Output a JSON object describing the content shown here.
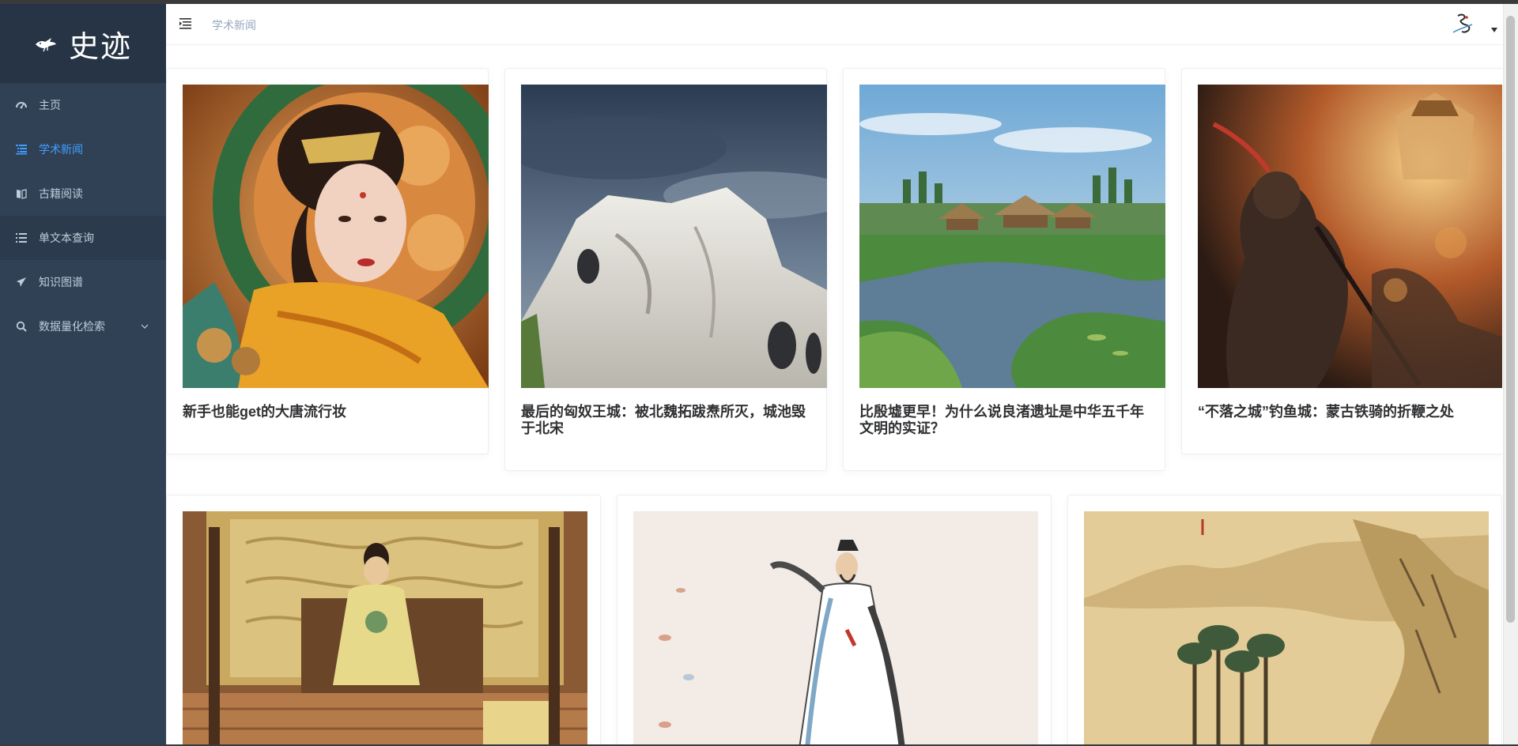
{
  "app": {
    "logo_text": "史迹",
    "logo_icon": "bird-logo-icon"
  },
  "sidebar": {
    "items": [
      {
        "label": "主页",
        "icon": "dashboard-icon"
      },
      {
        "label": "学术新闻",
        "icon": "list-indent-icon",
        "active": true
      },
      {
        "label": "古籍阅读",
        "icon": "book-icon"
      },
      {
        "label": "单文本查询",
        "icon": "list-icon"
      },
      {
        "label": "知识图谱",
        "icon": "send-icon"
      },
      {
        "label": "数据量化检索",
        "icon": "search-icon",
        "has_submenu": true
      }
    ]
  },
  "header": {
    "breadcrumb": "学术新闻",
    "menu_icon": "hamburger-icon",
    "avatar_icon": "avatar-icon"
  },
  "colors": {
    "sidebar_bg": "#304156",
    "logo_bg": "#263445",
    "active": "#409eff",
    "menu_text": "#bfcbd9"
  },
  "news": [
    {
      "title": "新手也能get的大唐流行妆",
      "image": "tang-lady-painting"
    },
    {
      "title": "最后的匈奴王城：被北魏拓跋焘所灭，城池毁于北宋",
      "image": "ruined-city-wall"
    },
    {
      "title": "比殷墟更早！为什么说良渚遗址是中华五千年文明的实证？",
      "image": "liangzhu-village-river"
    },
    {
      "title": "“不落之城”钓鱼城：蒙古铁骑的折鞭之处",
      "image": "battle-warrior-painting"
    },
    {
      "title": "",
      "image": "emperor-throne-painting"
    },
    {
      "title": "",
      "image": "scholar-in-robe-painting"
    },
    {
      "title": "",
      "image": "landscape-scroll-painting"
    }
  ]
}
